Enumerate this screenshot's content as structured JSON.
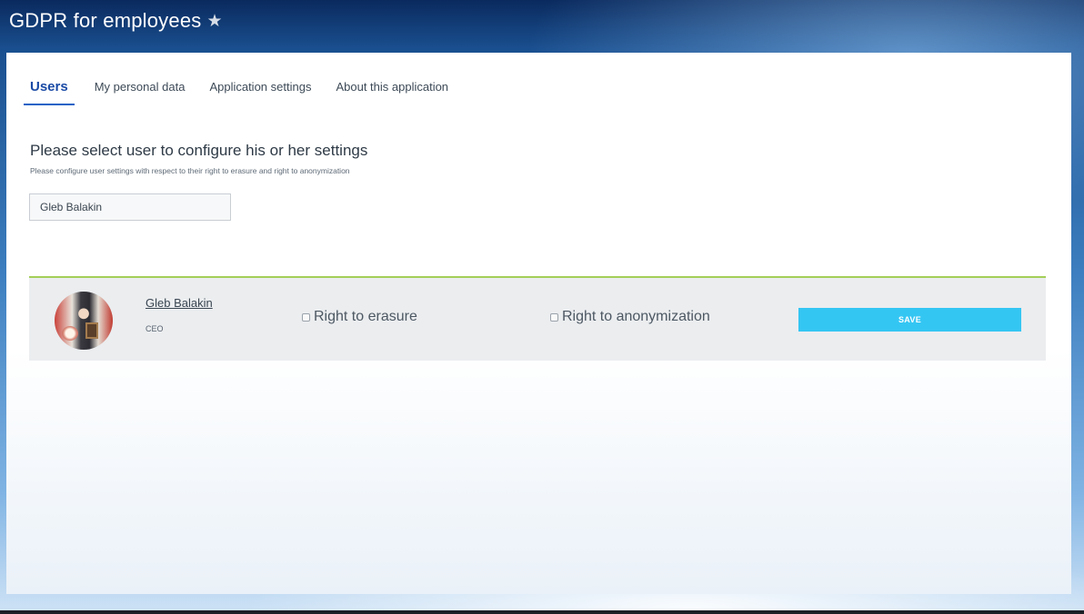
{
  "app": {
    "title": "GDPR for employees",
    "star_icon": "★"
  },
  "tabs": [
    {
      "label": "Users",
      "active": true
    },
    {
      "label": "My personal data",
      "active": false
    },
    {
      "label": "Application settings",
      "active": false
    },
    {
      "label": "About this application",
      "active": false
    }
  ],
  "section": {
    "title": "Please select user to configure his or her settings",
    "subtitle": "Please configure user settings with respect to their right to erasure and right to anonymization"
  },
  "user_select": {
    "value": "Gleb Balakin"
  },
  "user_row": {
    "name": "Gleb Balakin",
    "role": "CEO",
    "right_to_erasure_label": "Right to erasure",
    "right_to_erasure_checked": false,
    "right_to_anonymization_label": "Right to anonymization",
    "right_to_anonymization_checked": false,
    "save_label": "SAVE"
  },
  "colors": {
    "accent_tab": "#1e63c6",
    "row_border": "#a3cf57",
    "save_button": "#34c6f3"
  }
}
